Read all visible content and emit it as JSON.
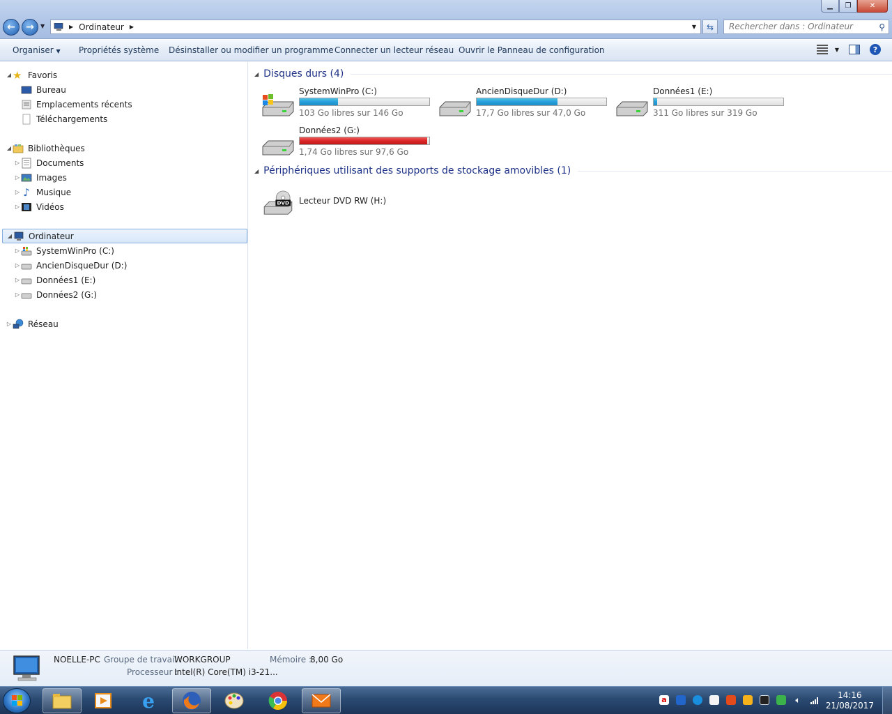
{
  "window": {
    "address": {
      "crumb": "Ordinateur"
    },
    "search": {
      "placeholder": "Rechercher dans : Ordinateur"
    }
  },
  "toolbar": {
    "organize": "Organiser",
    "system_props": "Propriétés système",
    "uninstall": "Désinstaller ou modifier un programme",
    "map_drive": "Connecter un lecteur réseau",
    "control_panel": "Ouvrir le Panneau de configuration"
  },
  "nav": {
    "favorites": "Favoris",
    "desktop": "Bureau",
    "recent": "Emplacements récents",
    "downloads": "Téléchargements",
    "libraries": "Bibliothèques",
    "documents": "Documents",
    "images": "Images",
    "music": "Musique",
    "videos": "Vidéos",
    "computer": "Ordinateur",
    "drive_c": "SystemWinPro (C:)",
    "drive_d": "AncienDisqueDur (D:)",
    "drive_e": "Données1 (E:)",
    "drive_g": "Données2 (G:)",
    "network": "Réseau"
  },
  "content": {
    "hard_disks_header": "Disques durs (4)",
    "drives": [
      {
        "name": "SystemWinPro (C:)",
        "free": "103 Go libres sur 146 Go",
        "used_fraction": 0.295
      },
      {
        "name": "AncienDisqueDur (D:)",
        "free": "17,7 Go libres sur 47,0 Go",
        "used_fraction": 0.623
      },
      {
        "name": "Données1 (E:)",
        "free": "311 Go libres sur 319 Go",
        "used_fraction": 0.025
      },
      {
        "name": "Données2 (G:)",
        "free": "1,74 Go libres sur 97,6 Go",
        "used_fraction": 0.982
      }
    ],
    "removable_header": "Périphériques utilisant des supports de stockage amovibles (1)",
    "dvd": {
      "name": "Lecteur DVD RW (H:)",
      "badge": "DVD"
    }
  },
  "details": {
    "pc_name": "NOELLE-PC",
    "workgroup_label": "Groupe de travail :",
    "workgroup": "WORKGROUP",
    "memory_label": "Mémoire :",
    "memory": "8,00 Go",
    "cpu_label": "Processeur :",
    "cpu": "Intel(R) Core(TM) i3-21..."
  },
  "taskbar": {
    "time": "14:16",
    "date": "21/08/2017"
  },
  "colors": {
    "bar_normal": "#26a0da",
    "bar_critical": "#da2626",
    "header_text": "#1e3287"
  }
}
